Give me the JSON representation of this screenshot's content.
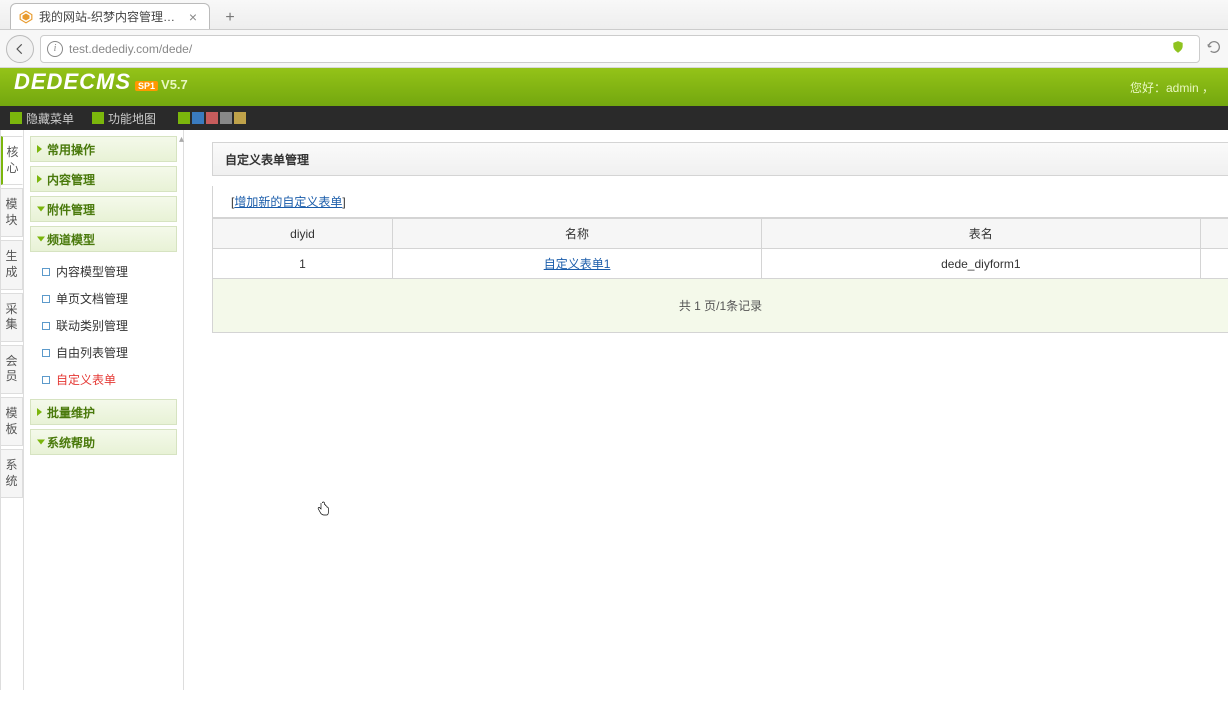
{
  "browser": {
    "tab_title": "我的网站-织梦内容管理系...",
    "url": "test.dedediy.com/dede/"
  },
  "header": {
    "logo_main": "DEDECMS",
    "logo_ver": "V5.7",
    "badge": "SP1",
    "greeting": "您好：admin ，"
  },
  "blackbar": {
    "hide_menu": "隐藏菜单",
    "site_map": "功能地图",
    "colors": [
      "#7bb60c",
      "#3a7bbf",
      "#c75c5c",
      "#888888",
      "#bfa24a"
    ]
  },
  "vtabs": [
    "核心",
    "模块",
    "生成",
    "采集",
    "会员",
    "模板",
    "系统"
  ],
  "active_vtab": 0,
  "menu": {
    "sections": [
      {
        "label": "常用操作",
        "open": false,
        "items": []
      },
      {
        "label": "内容管理",
        "open": false,
        "items": []
      },
      {
        "label": "附件管理",
        "open": true,
        "items": []
      },
      {
        "label": "频道模型",
        "open": true,
        "items": [
          "内容模型管理",
          "单页文档管理",
          "联动类别管理",
          "自由列表管理",
          "自定义表单"
        ],
        "active_index": 4
      },
      {
        "label": "批量维护",
        "open": false,
        "items": []
      },
      {
        "label": "系统帮助",
        "open": true,
        "items": []
      }
    ]
  },
  "content": {
    "title": "自定义表单管理",
    "add_link": "增加新的自定义表单",
    "columns": [
      "diyid",
      "名称",
      "表名"
    ],
    "rows": [
      {
        "diyid": "1",
        "name": "自定义表单1",
        "table": "dede_diyform1"
      }
    ],
    "pager": "共 1 页/1条记录"
  }
}
